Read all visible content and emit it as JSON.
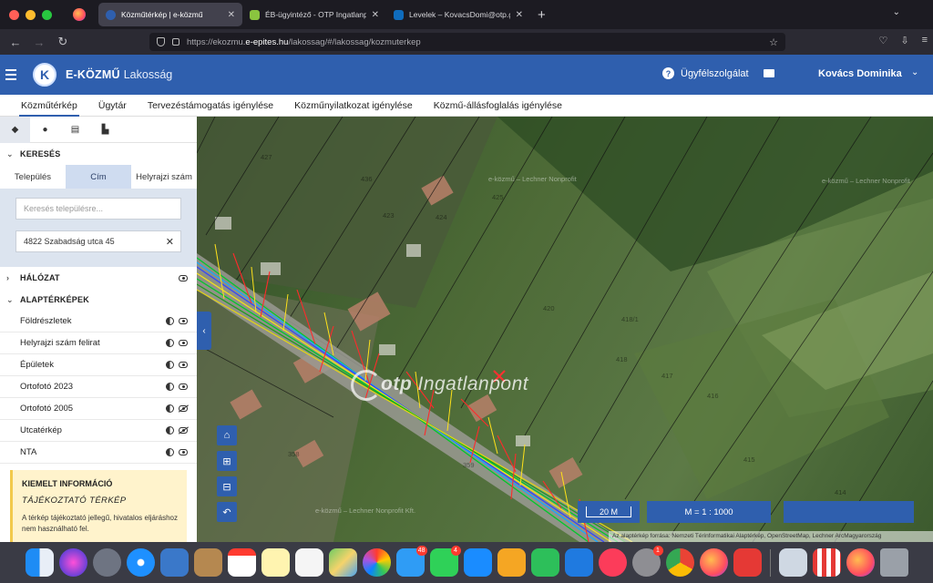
{
  "browser": {
    "tabs": [
      {
        "label": "Közműtérkép | e-közmű",
        "active": true,
        "color": "#2f5fae"
      },
      {
        "label": "ÉB-ügyintéző - OTP Ingatlanpont",
        "active": false,
        "color": "#8ac43f"
      },
      {
        "label": "Levelek – KovacsDomi@otp.group",
        "active": false,
        "color": "#0f6cbd"
      }
    ],
    "url_prefix": "https://ekozmu.",
    "url_domain": "e-epites.hu",
    "url_path": "/lakossag/#/lakossag/kozmuterkep"
  },
  "header": {
    "logo_letter": "K",
    "brand": "E-KÖZMŰ",
    "brand_sub": "Lakosság",
    "help_label": "Ügyfélszolgálat",
    "user_name": "Kovács Dominika"
  },
  "menu": {
    "items": [
      {
        "label": "Közműtérkép",
        "active": true
      },
      {
        "label": "Ügytár",
        "active": false
      },
      {
        "label": "Tervezéstámogatás igénylése",
        "active": false
      },
      {
        "label": "Közműnyilatkozat igénylése",
        "active": false
      },
      {
        "label": "Közmű-állásfoglalás igénylése",
        "active": false
      }
    ]
  },
  "sidebar": {
    "search_title": "KERESÉS",
    "search_modes": [
      "Település",
      "Cím",
      "Helyrajzi szám"
    ],
    "selected_mode": "Cím",
    "settlement_placeholder": "Keresés településre...",
    "address_value": "4822 Szabadság utca 45",
    "network_title": "HÁLÓZAT",
    "basemaps_title": "ALAPTÉRKÉPEK",
    "layers": [
      {
        "label": "Földrészletek",
        "visible": true
      },
      {
        "label": "Helyrajzi szám felirat",
        "visible": true
      },
      {
        "label": "Épületek",
        "visible": true
      },
      {
        "label": "Ortofotó 2023",
        "visible": true
      },
      {
        "label": "Ortofotó 2005",
        "visible": false
      },
      {
        "label": "Utcatérkép",
        "visible": false
      },
      {
        "label": "NTA",
        "visible": true
      }
    ],
    "info_title": "KIEMELT INFORMÁCIÓ",
    "info_subtitle": "TÁJÉKOZTATÓ TÉRKÉP",
    "info_text": "A térkép tájékoztató jellegű, hivatalos eljáráshoz nem használható fel."
  },
  "map": {
    "watermark_brand": "otp",
    "watermark_rest": " Ingatlanpont",
    "ghost_1": "e-közmű – Lechner Nonprofit",
    "ghost_2": "e-közmű – Lechner Nonprofit",
    "ghost_3": "e-közmű – Lechner Nonprofit Kft.",
    "parcels": [
      "427",
      "436",
      "425",
      "424",
      "423",
      "420",
      "418/1",
      "418",
      "417",
      "416",
      "415",
      "414",
      "358",
      "359"
    ],
    "scale_label": "20 M",
    "ratio_label": "M = 1 : 1000",
    "attribution": "Az alaptérkép forrása: Nemzeti Térinformatikai Alaptérkép, OpenStreetMap, Lechner ArcMagyarország"
  },
  "dock": {
    "badges": {
      "mail": "48",
      "messages": "4",
      "settings": "1"
    }
  }
}
